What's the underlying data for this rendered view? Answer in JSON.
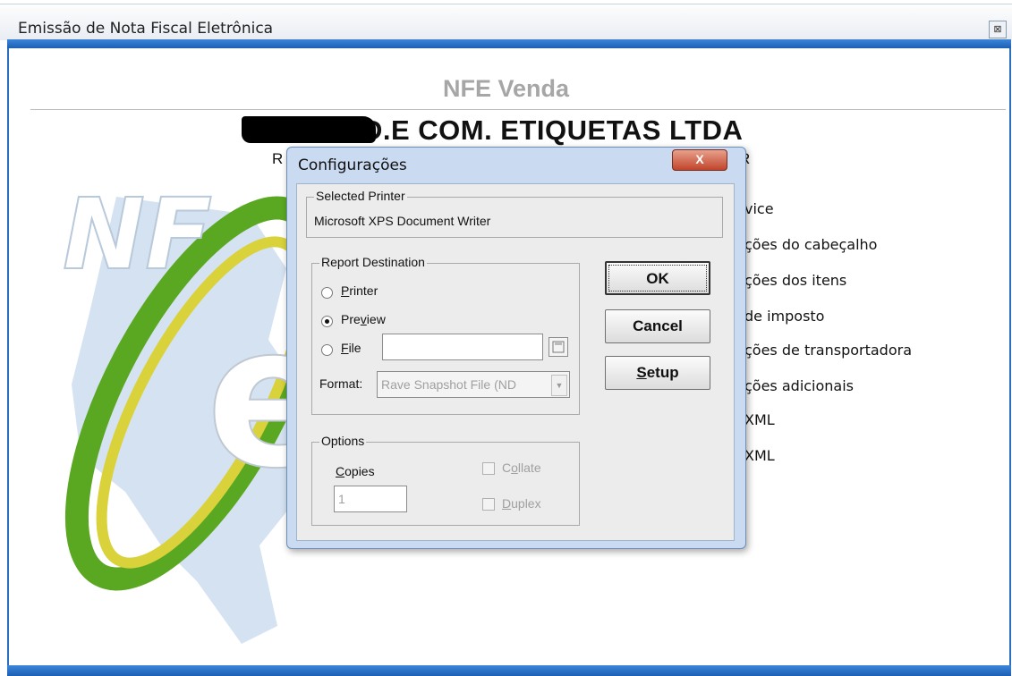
{
  "window": {
    "title": "Emissão de Nota Fiscal Eletrônica",
    "close_glyph": "⊠"
  },
  "main": {
    "section_title": "NFE Venda",
    "company_name": "MEGA IND.E COM. ETIQUETAS LTDA",
    "sub_left": "R",
    "sub_right": "R",
    "menu_items": [
      "vice",
      "ções do cabeçalho",
      "ções dos itens",
      "de imposto",
      "ções de transportadora",
      "ções adicionais",
      "XML",
      "XML"
    ],
    "logo_text": {
      "nf": "NF",
      "e": "e"
    }
  },
  "dialog": {
    "title": "Configurações",
    "close_glyph": "X",
    "selected_printer": {
      "label": "Selected Printer",
      "value": "Microsoft XPS Document Writer"
    },
    "report_destination": {
      "label": "Report Destination",
      "printer_label_u": "P",
      "printer_label_rest": "rinter",
      "preview_label_a": "Pre",
      "preview_label_u": "v",
      "preview_label_b": "iew",
      "file_label_u": "F",
      "file_label_rest": "ile",
      "file_value": "",
      "format_label": "Format:",
      "format_value": "Rave Snapshot File (ND"
    },
    "options": {
      "label": "Options",
      "copies_label_u": "C",
      "copies_label_rest": "opies",
      "copies_value": "1",
      "collate_a": "C",
      "collate_u": "o",
      "collate_b": "llate",
      "duplex_u": "D",
      "duplex_rest": "uplex"
    },
    "buttons": {
      "ok": "OK",
      "cancel": "Cancel",
      "setup_u": "S",
      "setup_rest": "etup"
    }
  },
  "colors": {
    "accent_blue": "#1b5fb4",
    "dialog_frame": "#c9daf1",
    "logo_green": "#6fbf2a",
    "logo_yellow": "#d9d23a"
  }
}
